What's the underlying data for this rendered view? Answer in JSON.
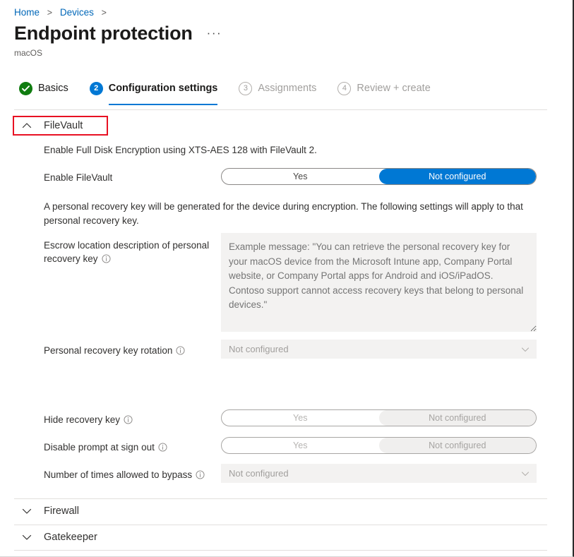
{
  "breadcrumb": {
    "items": [
      "Home",
      "Devices"
    ],
    "separator": ">"
  },
  "header": {
    "title": "Endpoint protection",
    "more_label": "···",
    "subtitle": "macOS"
  },
  "wizard": {
    "steps": [
      {
        "marker": "✓",
        "label": "Basics",
        "state": "done"
      },
      {
        "marker": "2",
        "label": "Configuration settings",
        "state": "active"
      },
      {
        "marker": "3",
        "label": "Assignments",
        "state": "todo"
      },
      {
        "marker": "4",
        "label": "Review + create",
        "state": "todo"
      }
    ]
  },
  "sections": {
    "filevault": {
      "label": "FileVault",
      "expanded": true,
      "description": "Enable Full Disk Encryption using XTS-AES 128 with FileVault 2.",
      "note": "A personal recovery key will be generated for the device during encryption. The following settings will apply to that personal recovery key.",
      "fields": {
        "enable_filevault": {
          "label": "Enable FileVault",
          "info": true,
          "control": "toggle",
          "options": [
            "Yes",
            "Not configured"
          ],
          "selected": "Not configured",
          "disabled": false
        },
        "escrow_location": {
          "label": "Escrow location description of personal recovery key",
          "info": true,
          "control": "textarea",
          "value": "",
          "placeholder": "Example message: \"You can retrieve the personal recovery key for your macOS device from the Microsoft Intune app, Company Portal website, or Company Portal apps for Android and iOS/iPadOS. Contoso support cannot access recovery keys that belong to personal devices.\""
        },
        "key_rotation": {
          "label": "Personal recovery key rotation",
          "info": true,
          "control": "dropdown",
          "value": "Not configured",
          "disabled": true
        },
        "hide_recovery_key": {
          "label": "Hide recovery key",
          "info": true,
          "control": "toggle",
          "options": [
            "Yes",
            "Not configured"
          ],
          "selected": "Not configured",
          "disabled": true
        },
        "disable_prompt": {
          "label": "Disable prompt at sign out",
          "info": true,
          "control": "toggle",
          "options": [
            "Yes",
            "Not configured"
          ],
          "selected": "Not configured",
          "disabled": true
        },
        "bypass_count": {
          "label": "Number of times allowed to bypass",
          "info": true,
          "control": "dropdown",
          "value": "Not configured",
          "disabled": true
        }
      }
    },
    "firewall": {
      "label": "Firewall",
      "expanded": false
    },
    "gatekeeper": {
      "label": "Gatekeeper",
      "expanded": false
    }
  },
  "colors": {
    "accent": "#0078D4",
    "link": "#0067B8",
    "success": "#107C10",
    "highlight": "#E81123",
    "disabled_text": "#A19F9D",
    "field_bg": "#F3F2F1"
  }
}
